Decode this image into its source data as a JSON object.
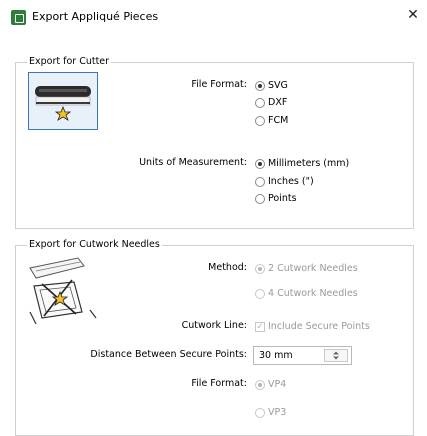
{
  "window": {
    "title": "Export Appliqué Pieces",
    "close_glyph": "✕"
  },
  "cutter": {
    "legend": "Export for Cutter",
    "file_format_label": "File Format:",
    "file_format_options": [
      "SVG",
      "DXF",
      "FCM"
    ],
    "file_format_selected": "SVG",
    "units_label": "Units of Measurement:",
    "units_options": [
      "Millimeters (mm)",
      "Inches (\")",
      "Points"
    ],
    "units_selected": "Millimeters (mm)"
  },
  "cutwork": {
    "legend": "Export for Cutwork Needles",
    "method_label": "Method:",
    "method_options": [
      "2 Cutwork Needles",
      "4 Cutwork Needles"
    ],
    "method_selected": "2 Cutwork Needles",
    "cutwork_line_label": "Cutwork Line:",
    "include_secure_points_label": "Include Secure Points",
    "include_secure_points_checked": true,
    "distance_label": "Distance Between Secure Points:",
    "distance_value": "30 mm",
    "file_format_label": "File Format:",
    "file_format_options": [
      "VP4",
      "VP3"
    ],
    "file_format_selected": "VP4"
  },
  "icons": {
    "app": "app-icon",
    "cutter_illustration": "cutter-machine-icon",
    "cutwork_illustration": "cutwork-needles-icon",
    "spinner": "up-down-arrows-icon"
  }
}
